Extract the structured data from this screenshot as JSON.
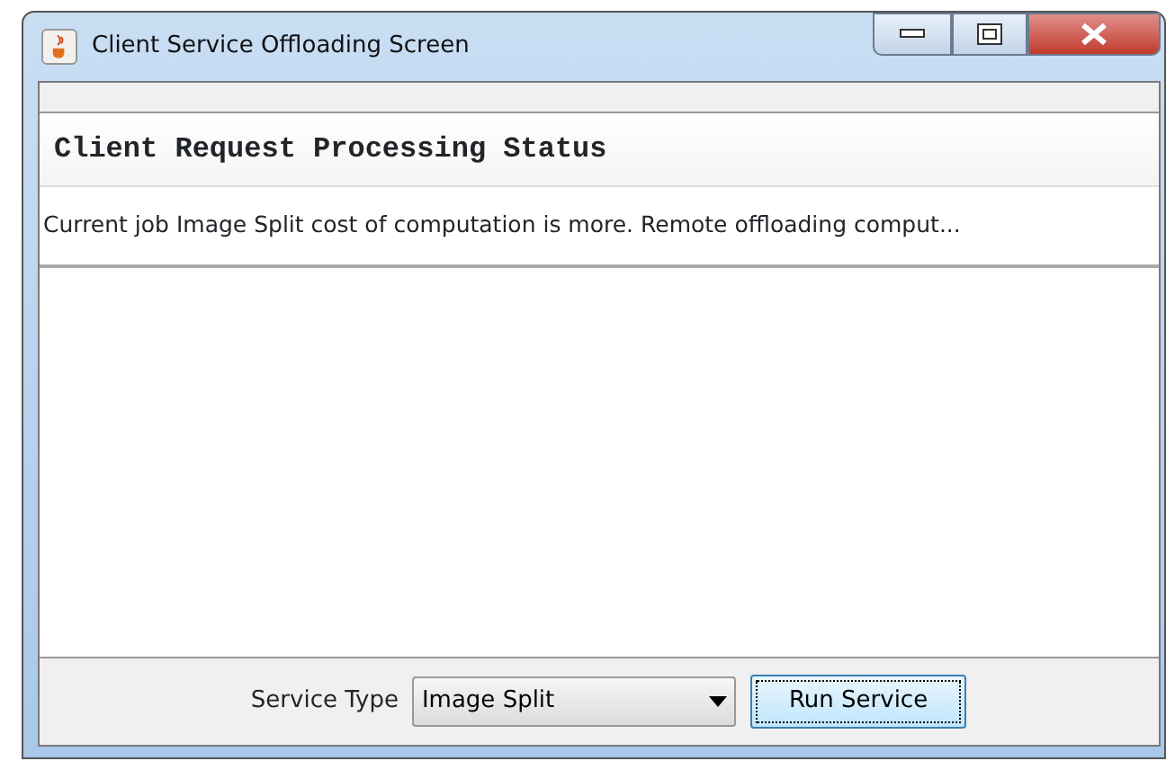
{
  "window": {
    "title": "Client Service Offloading Screen"
  },
  "status_table": {
    "heading": "Client Request Processing Status",
    "rows": [
      "Current job Image Split cost of computation is more. Remote offloading comput..."
    ]
  },
  "controls": {
    "service_type_label": "Service Type",
    "service_type_value": "Image Split",
    "run_button": "Run Service"
  }
}
